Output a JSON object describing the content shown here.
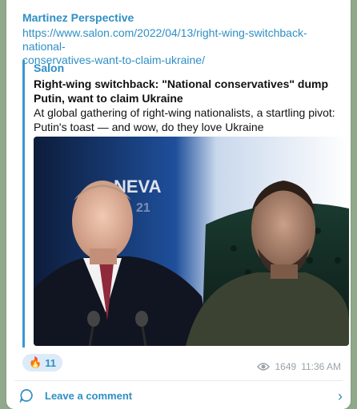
{
  "post": {
    "channel": "Martinez Perspective",
    "link_line1": "https://www.salon.com/2022/04/13/right-wing-switchback-national-",
    "link_line2": "conservatives-want-to-claim-ukraine/"
  },
  "preview": {
    "site": "Salon",
    "title": "Right-wing switchback: \"National conservatives\" dump Putin, want to claim Ukraine",
    "description": "At global gathering of right-wing nationalists, a startling pivot: Putin's toast — and wow, do they love Ukraine",
    "image_text_big": "NEVA",
    "image_text_small": "21"
  },
  "reaction": {
    "emoji": "🔥",
    "count": "11"
  },
  "meta": {
    "views": "1649",
    "time": "11:36 AM"
  },
  "footer": {
    "comment_label": "Leave a comment",
    "chevron": "›"
  },
  "colors": {
    "accent": "#2f8fc4",
    "bg": "#8fa98a"
  }
}
